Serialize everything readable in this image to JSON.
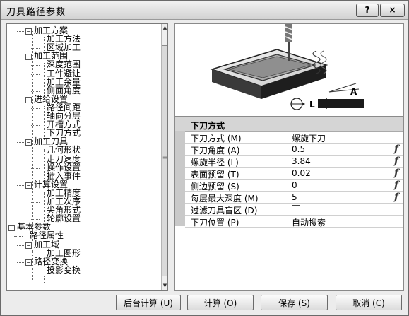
{
  "window": {
    "title": "刀具路径参数",
    "help_button": "?",
    "close_button": "×"
  },
  "tree": {
    "items": [
      {
        "label": "加工方案"
      },
      {
        "label": "加工方法"
      },
      {
        "label": "区域加工"
      },
      {
        "label": "加工范围"
      },
      {
        "label": "深度范围"
      },
      {
        "label": "工件避让"
      },
      {
        "label": "加工余量"
      },
      {
        "label": "侧面角度"
      },
      {
        "label": "进给设置"
      },
      {
        "label": "路径间距"
      },
      {
        "label": "轴向分层"
      },
      {
        "label": "开槽方式"
      },
      {
        "label": "下刀方式"
      },
      {
        "label": "加工刀具"
      },
      {
        "label": "几何形状"
      },
      {
        "label": "走刀速度"
      },
      {
        "label": "操作设置"
      },
      {
        "label": "插入事件"
      },
      {
        "label": "计算设置"
      },
      {
        "label": "加工精度"
      },
      {
        "label": "加工次序"
      },
      {
        "label": "尖角形式"
      },
      {
        "label": "轮廓设置"
      },
      {
        "label": "基本参数"
      },
      {
        "label": "路径属性"
      },
      {
        "label": "加工域"
      },
      {
        "label": "加工图形"
      },
      {
        "label": "路径变换"
      },
      {
        "label": "投影变换"
      }
    ],
    "expander_symbol": "−",
    "scroll_up": "▲",
    "scroll_down": "▼",
    "scroll_grip": "≡"
  },
  "illustration": {
    "label_L": "L",
    "label_A": "A"
  },
  "props": {
    "header": "下刀方式",
    "rows": [
      {
        "label": "下刀方式 (M)",
        "value": "螺旋下刀",
        "fx": ""
      },
      {
        "label": "下刀角度 (A)",
        "value": "0.5",
        "fx": "f"
      },
      {
        "label": "螺旋半径 (L)",
        "value": "3.84",
        "fx": "f"
      },
      {
        "label": "表面预留 (T)",
        "value": "0.02",
        "fx": "f"
      },
      {
        "label": "侧边预留 (S)",
        "value": "0",
        "fx": "f"
      },
      {
        "label": "每层最大深度 (M)",
        "value": "5",
        "fx": "f"
      },
      {
        "label": "过滤刀具盲区 (D)",
        "value": "",
        "fx": ""
      },
      {
        "label": "下刀位置 (P)",
        "value": "自动搜索",
        "fx": ""
      }
    ]
  },
  "buttons": {
    "background_calc": "后台计算 (U)",
    "calc": "计算 (O)",
    "save": "保存 (S)",
    "cancel": "取消 (C)"
  }
}
